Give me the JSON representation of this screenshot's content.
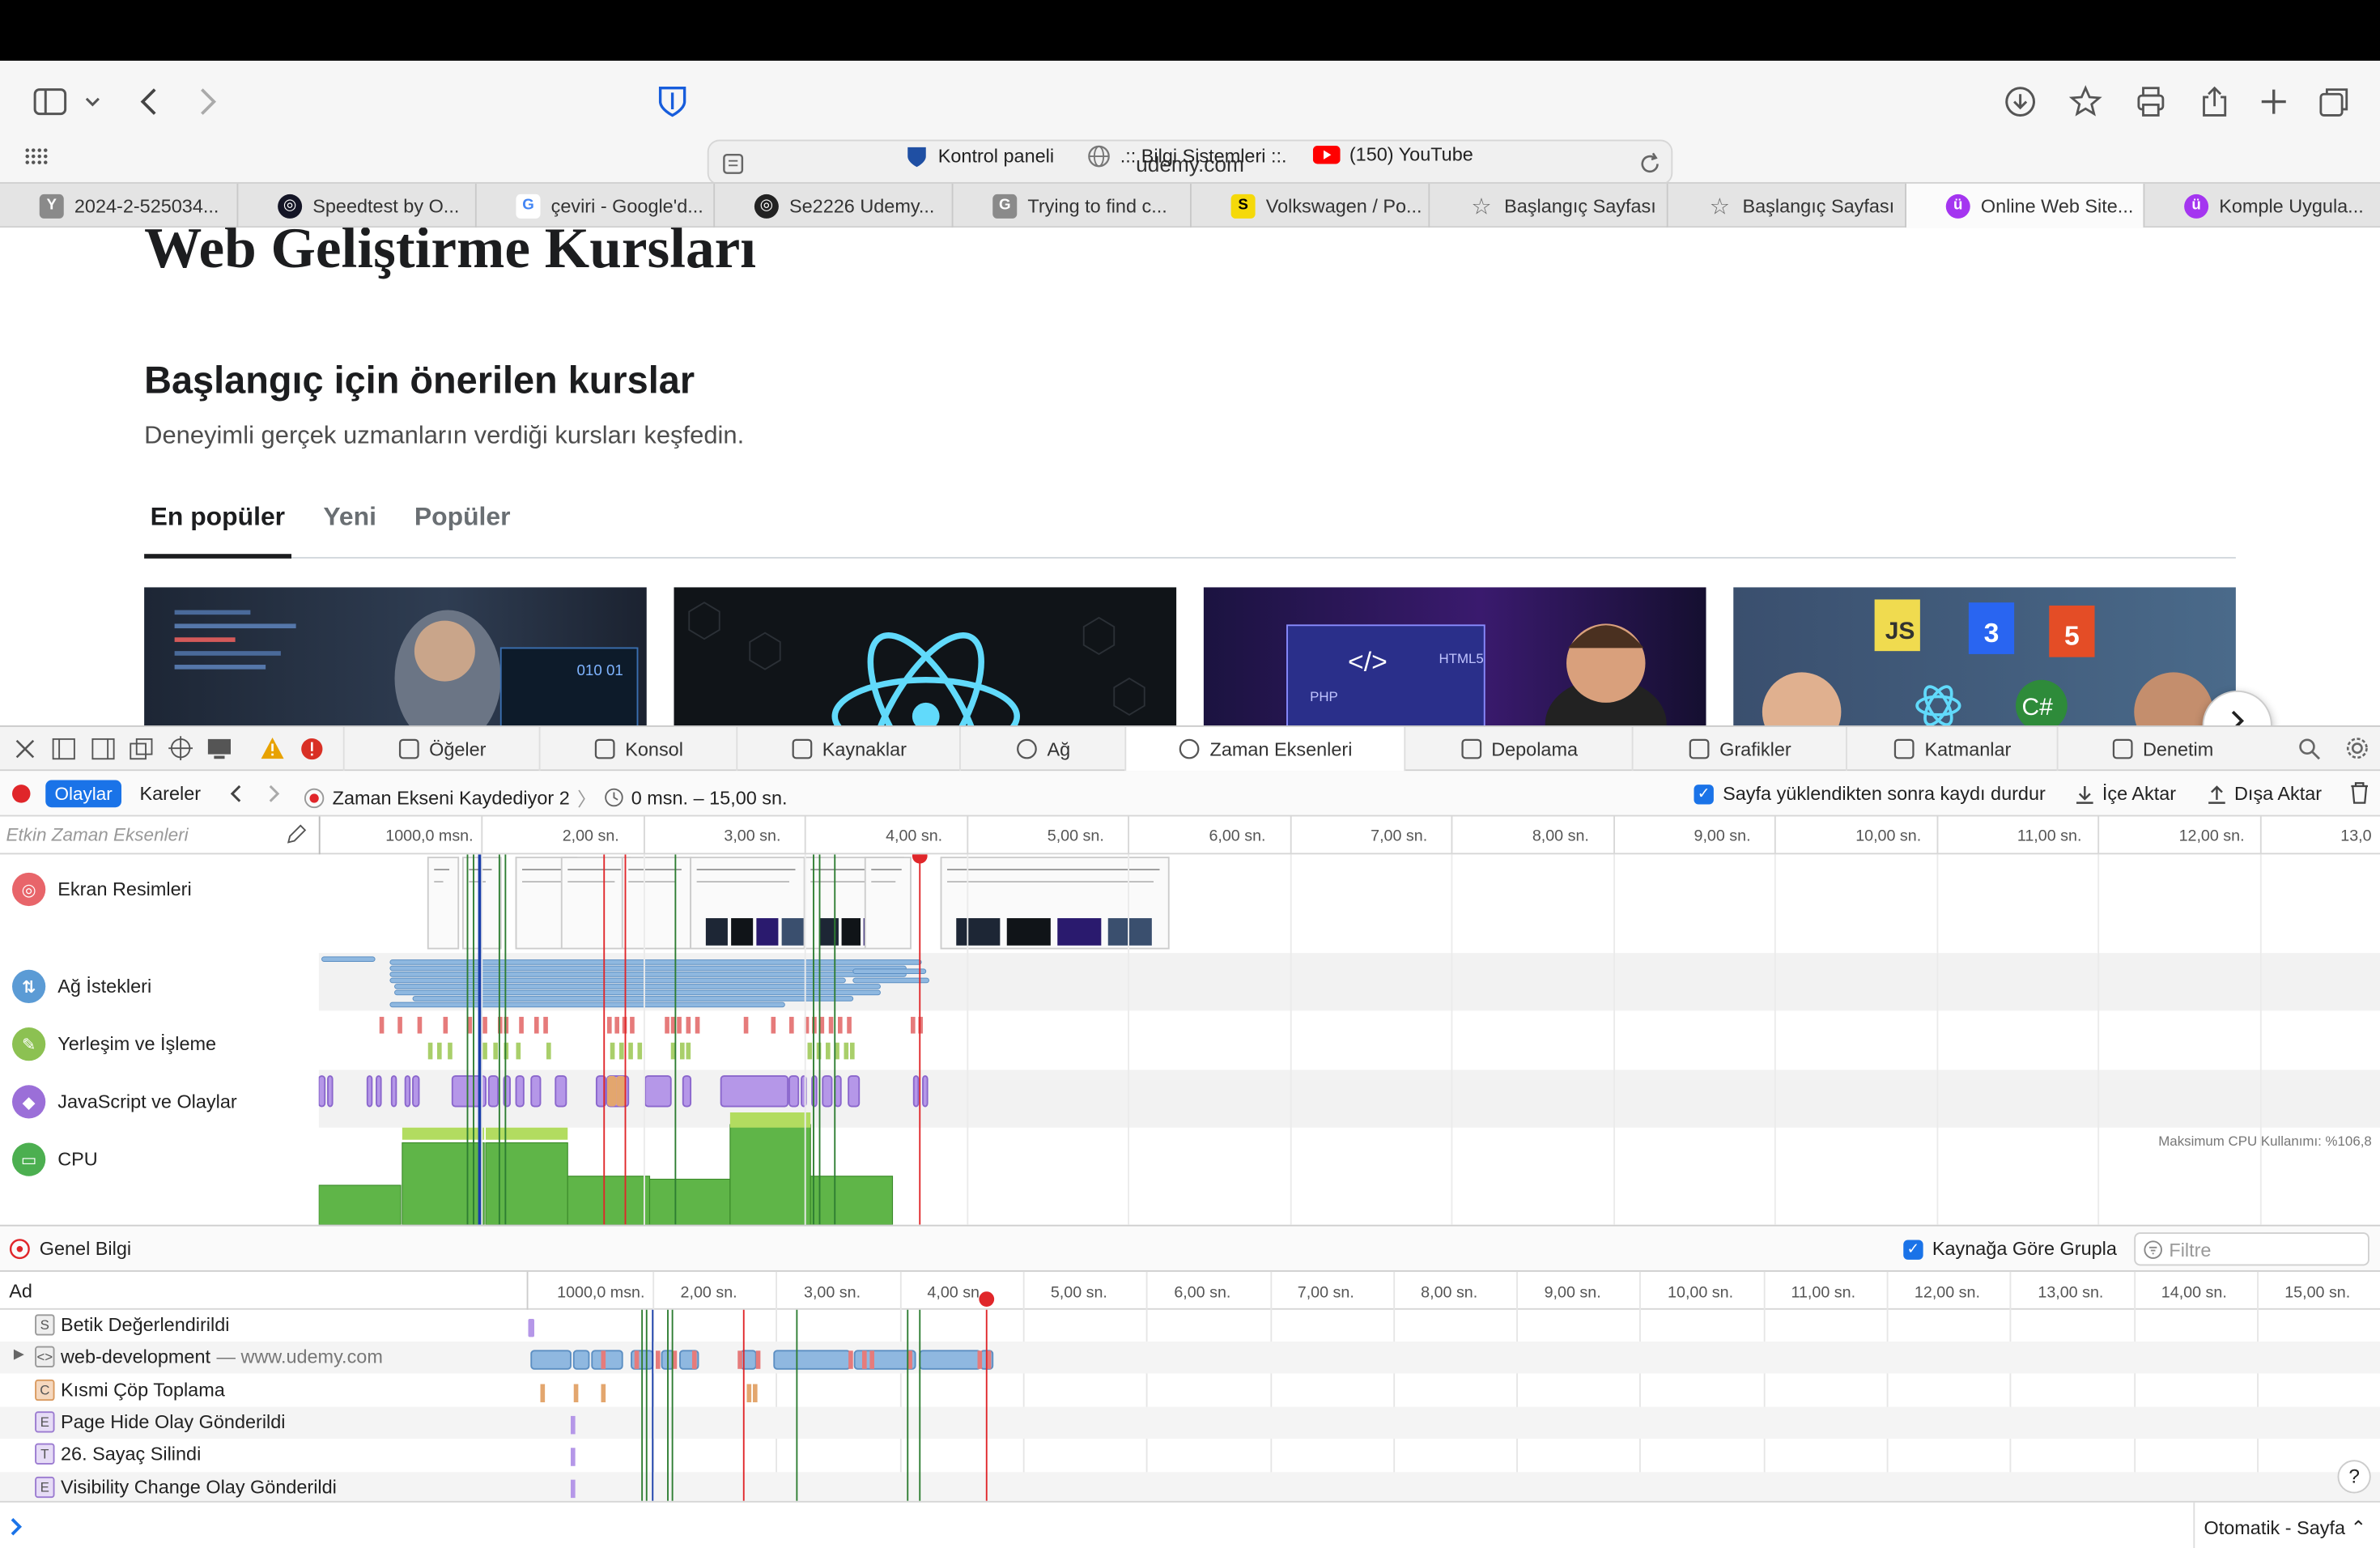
{
  "browser": {
    "url": "udemy.com",
    "favorites": [
      {
        "label": "Kontrol paneli"
      },
      {
        "label": ".:: Bilgi Sistemleri ::."
      },
      {
        "label": "(150) YouTube"
      }
    ],
    "tabs": [
      {
        "label": "2024-2-525034...",
        "icon": "Y",
        "color": "#8a8a8a"
      },
      {
        "label": "Speedtest by O...",
        "icon": "speedtest-icon",
        "color": "#141526"
      },
      {
        "label": "çeviri - Google'd...",
        "icon": "G",
        "color": "#4285f4"
      },
      {
        "label": "Se2226 Udemy...",
        "icon": "chatgpt-icon",
        "color": "#222222"
      },
      {
        "label": "Trying to find c...",
        "icon": "G",
        "color": "#8a8a8a"
      },
      {
        "label": "Volkswagen / Po...",
        "icon": "S",
        "color": "#f5d90a"
      },
      {
        "label": "Başlangıç Sayfası",
        "icon": "star-icon",
        "color": "#666666"
      },
      {
        "label": "Başlangıç Sayfası",
        "icon": "star-icon",
        "color": "#666666"
      },
      {
        "label": "Online Web Site...",
        "icon": "udemy-icon",
        "color": "#a435f0"
      },
      {
        "label": "Komple Uygula...",
        "icon": "udemy-icon",
        "color": "#a435f0"
      }
    ]
  },
  "page": {
    "title": "Web Geliştirme Kursları",
    "section_title": "Başlangıç için önerilen kurslar",
    "section_subtitle": "Deneyimli gerçek uzmanların verdiği kursları keşfedin.",
    "tabs": [
      "En popüler",
      "Yeni",
      "Popüler"
    ]
  },
  "devtools": {
    "tabs": [
      "Öğeler",
      "Konsol",
      "Kaynaklar",
      "Ağ",
      "Zaman Eksenleri",
      "Depolama",
      "Grafikler",
      "Katmanlar",
      "Denetim"
    ],
    "active_tab": "Zaman Eksenleri",
    "mode_events": "Olaylar",
    "mode_frames": "Kareler",
    "recording_label": "Zaman Ekseni Kaydediyor 2",
    "range_label": "0 msn. – 15,00 sn.",
    "stop_after_load": "Sayfa yüklendikten sonra kaydı durdur",
    "import": "İçe Aktar",
    "export": "Dışa Aktar",
    "filter_placeholder": "Etkin Zaman Eksenleri",
    "ruler_labels": [
      "1000,0 msn.",
      "2,00 sn.",
      "3,00 sn.",
      "4,00 sn.",
      "5,00 sn.",
      "6,00 sn.",
      "7,00 sn.",
      "8,00 sn.",
      "9,00 sn.",
      "10,00 sn.",
      "11,00 sn.",
      "12,00 sn.",
      "13,0"
    ],
    "lanes": [
      {
        "label": "Ekran Resimleri",
        "color": "#e8656a",
        "icon": "screenshot-icon"
      },
      {
        "label": "Ağ İstekleri",
        "color": "#5b9bd5",
        "icon": "network-icon"
      },
      {
        "label": "Yerleşim ve İşleme",
        "color": "#8cc152",
        "icon": "paint-icon"
      },
      {
        "label": "JavaScript ve Olaylar",
        "color": "#9b6fd8",
        "icon": "script-icon"
      },
      {
        "label": "CPU",
        "color": "#4caf50",
        "icon": "cpu-icon"
      }
    ],
    "cpu_max": "Maksimum CPU Kullanımı: %106,8",
    "overview_label": "Genel Bilgi",
    "group_by_source": "Kaynağa Göre Grupla",
    "filter_label": "Filtre",
    "table_header": "Ad",
    "table_ruler": [
      "1000,0 msn.",
      "2,00 sn.",
      "3,00 sn.",
      "4,00 sn.",
      "5,00 sn.",
      "6,00 sn.",
      "7,00 sn.",
      "8,00 sn.",
      "9,00 sn.",
      "10,00 sn.",
      "11,00 sn.",
      "12,00 sn.",
      "13,00 sn.",
      "14,00 sn.",
      "15,00 sn."
    ],
    "rows": [
      {
        "badge": "S",
        "name": "Betik Değerlendirildi",
        "suffix": ""
      },
      {
        "badge": "<>",
        "name": "web-development",
        "suffix": " — www.udemy.com"
      },
      {
        "badge": "C",
        "name": "Kısmi Çöp Toplama",
        "suffix": ""
      },
      {
        "badge": "E",
        "name": "Page Hide Olay Gönderildi",
        "suffix": ""
      },
      {
        "badge": "T",
        "name": "26. Sayaç Silindi",
        "suffix": ""
      },
      {
        "badge": "E",
        "name": "Visibility Change Olay Gönderildi",
        "suffix": ""
      }
    ],
    "zoom_mode": "Otomatik - Sayfa"
  }
}
